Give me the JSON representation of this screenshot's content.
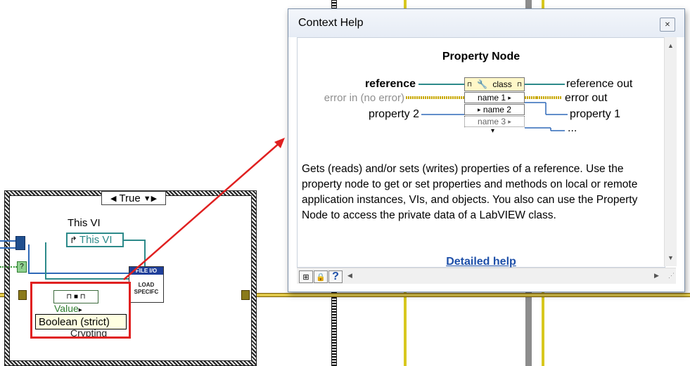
{
  "diagram": {
    "case_selector": {
      "value": "True",
      "left_arrow": "◀",
      "right_arrow": "▼▶"
    },
    "this_vi_label": "This VI",
    "this_vi_node_text": "This VI",
    "fileio_header": "FILE I/O",
    "fileio_body_line1": "LOAD",
    "fileio_body_line2": "SPECIFC",
    "value_label": "Value",
    "tooltip": "Boolean (strict)",
    "partial_label": "Crypting"
  },
  "context_help": {
    "window_title": "Context Help",
    "node_title": "Property Node",
    "inputs": {
      "reference": "reference",
      "error_in": "error in (no error)",
      "property2": "property 2"
    },
    "outputs": {
      "reference_out": "reference out",
      "error_out": "error out",
      "property1": "property 1",
      "more": "..."
    },
    "node_rows": {
      "class": "class",
      "name1": "name 1",
      "name2": "name 2",
      "name3": "name 3"
    },
    "description": "Gets (reads) and/or sets (writes) properties of a reference. Use the property node to get or set properties and methods on local or remote application instances, VIs, and objects. You also can use the Property Node to access the private data of a LabVIEW class.",
    "detailed_help": "Detailed help",
    "bottom_buttons": {
      "help": "?"
    }
  },
  "colors": {
    "highlight": "#e02020",
    "link": "#1d4fa8",
    "ref_wire": "#2d8a8a",
    "error_wire": "#d8c81f"
  }
}
